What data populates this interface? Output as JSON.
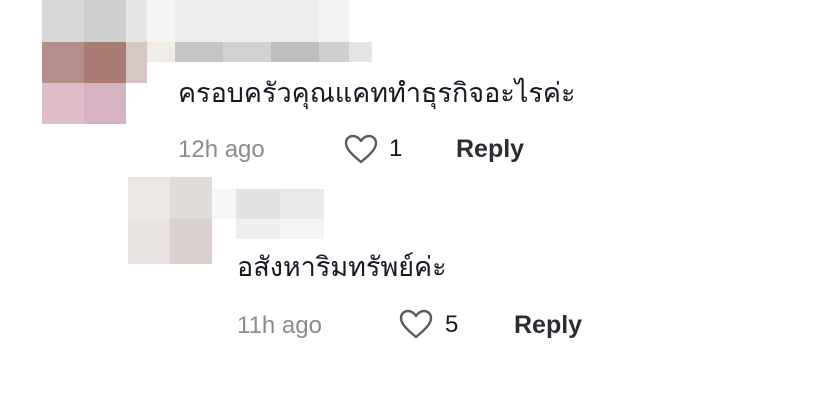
{
  "comments": [
    {
      "text": "ครอบครัวคุณแคททำธุรกิจอะไรค่ะ",
      "time": "12h ago",
      "likes": "1",
      "reply_label": "Reply",
      "like_icon": "heart-outline-icon"
    },
    {
      "text": "อสังหาริมทรัพย์ค่ะ",
      "time": "11h ago",
      "likes": "5",
      "reply_label": "Reply",
      "like_icon": "heart-outline-icon"
    }
  ],
  "colors": {
    "text": "#161823",
    "meta": "#8a8b91",
    "icon": "#5a5b60"
  }
}
